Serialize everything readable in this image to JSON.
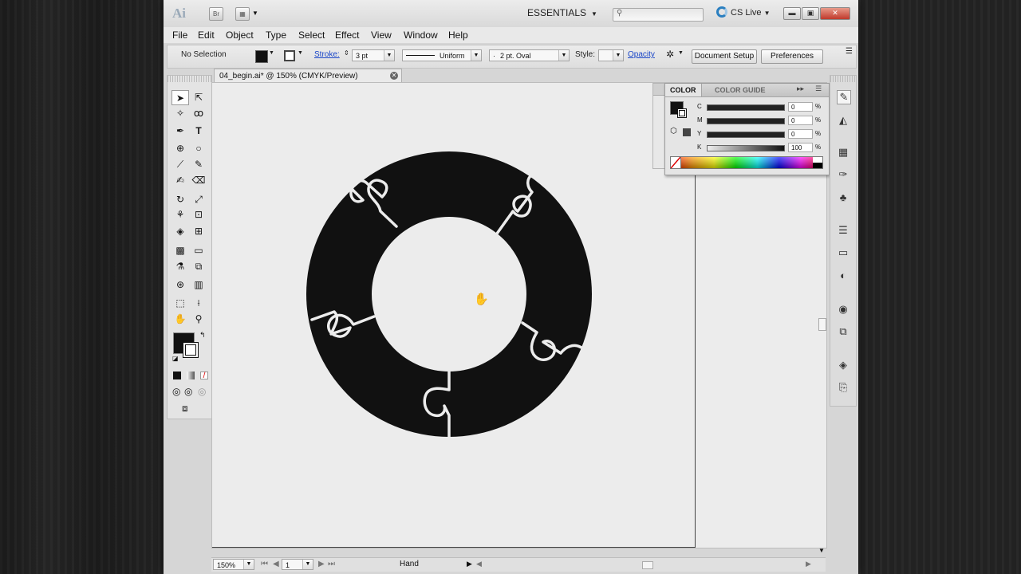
{
  "appbar": {
    "logo": "Ai",
    "bridge": "Br",
    "workspace": "ESSENTIALS",
    "search_placeholder": "",
    "cs_live": "CS Live"
  },
  "menu": [
    "File",
    "Edit",
    "Object",
    "Type",
    "Select",
    "Effect",
    "View",
    "Window",
    "Help"
  ],
  "control": {
    "selection": "No Selection",
    "stroke_label": "Stroke:",
    "stroke_weight": "3 pt",
    "profile": "Uniform",
    "brush": "2 pt. Oval",
    "style_label": "Style:",
    "opacity_label": "Opacity",
    "document_setup": "Document Setup",
    "preferences": "Preferences"
  },
  "document": {
    "tab_title": "04_begin.ai* @ 150% (CMYK/Preview)"
  },
  "status": {
    "zoom": "150%",
    "page": "1",
    "tool": "Hand"
  },
  "color_panel": {
    "tab_color": "COLOR",
    "tab_guide": "COLOR GUIDE",
    "channels": [
      {
        "label": "C",
        "value": "0"
      },
      {
        "label": "M",
        "value": "0"
      },
      {
        "label": "Y",
        "value": "0"
      },
      {
        "label": "K",
        "value": "100"
      }
    ],
    "percent": "%"
  },
  "colors": {
    "puzzle_fill": "#111111",
    "cs_live_blue": "#2a7fc0",
    "link_blue": "#1a46c8"
  }
}
